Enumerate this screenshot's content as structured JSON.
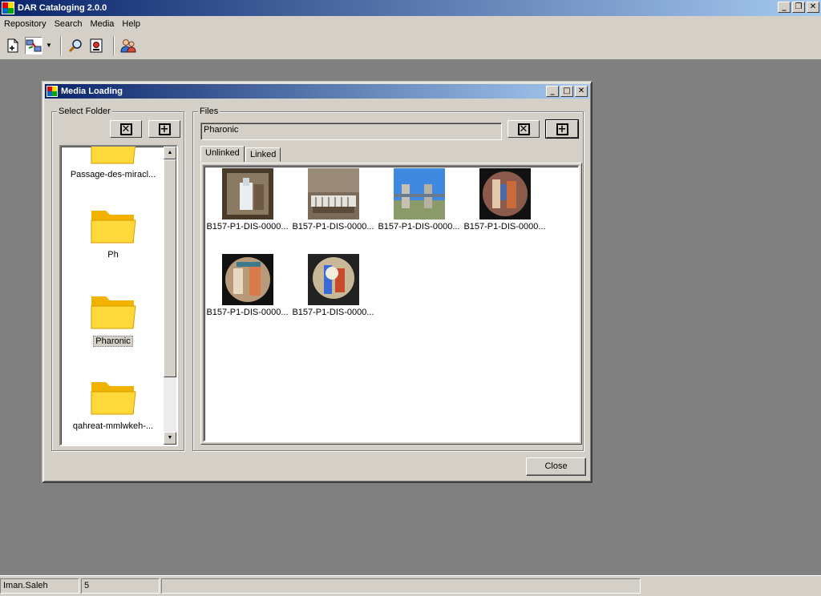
{
  "app": {
    "title": "DAR Cataloging 2.0.0",
    "controls": {
      "minimize": "_",
      "restore": "❐",
      "close": "✕"
    }
  },
  "menubar": {
    "items": [
      {
        "label": "Repository"
      },
      {
        "label": "Search"
      },
      {
        "label": "Media"
      },
      {
        "label": "Help"
      }
    ]
  },
  "toolbar": {
    "icons": [
      "new-document-icon",
      "link-media-icon",
      "search-icon",
      "certificate-icon",
      "users-icon"
    ]
  },
  "dialog": {
    "title": "Media Loading",
    "folders_group": {
      "label": "Select Folder",
      "items": [
        {
          "label": "Passage-des-miracl..."
        },
        {
          "label": "Ph"
        },
        {
          "label": "Pharonic"
        },
        {
          "label": "qahreat-mmlwkeh-..."
        }
      ],
      "selected": "Pharonic"
    },
    "files_group": {
      "label": "Files",
      "path": "Pharonic",
      "tabs": [
        {
          "label": "Unlinked"
        },
        {
          "label": "Linked"
        }
      ],
      "active_tab": "Unlinked",
      "thumbnails": [
        {
          "caption": "B157-P1-DIS-0000..."
        },
        {
          "caption": "B157-P1-DIS-0000..."
        },
        {
          "caption": "B157-P1-DIS-0000..."
        },
        {
          "caption": "B157-P1-DIS-0000..."
        },
        {
          "caption": "B157-P1-DIS-0000..."
        },
        {
          "caption": "B157-P1-DIS-0000..."
        }
      ]
    },
    "close_label": "Close"
  },
  "statusbar": {
    "user": "Iman.Saleh",
    "count": "5",
    "message": ""
  },
  "colors": {
    "title_gradient_start": "#0a246a",
    "title_gradient_end": "#a6caf0",
    "face": "#d4d0c8",
    "desktop": "#808080"
  }
}
